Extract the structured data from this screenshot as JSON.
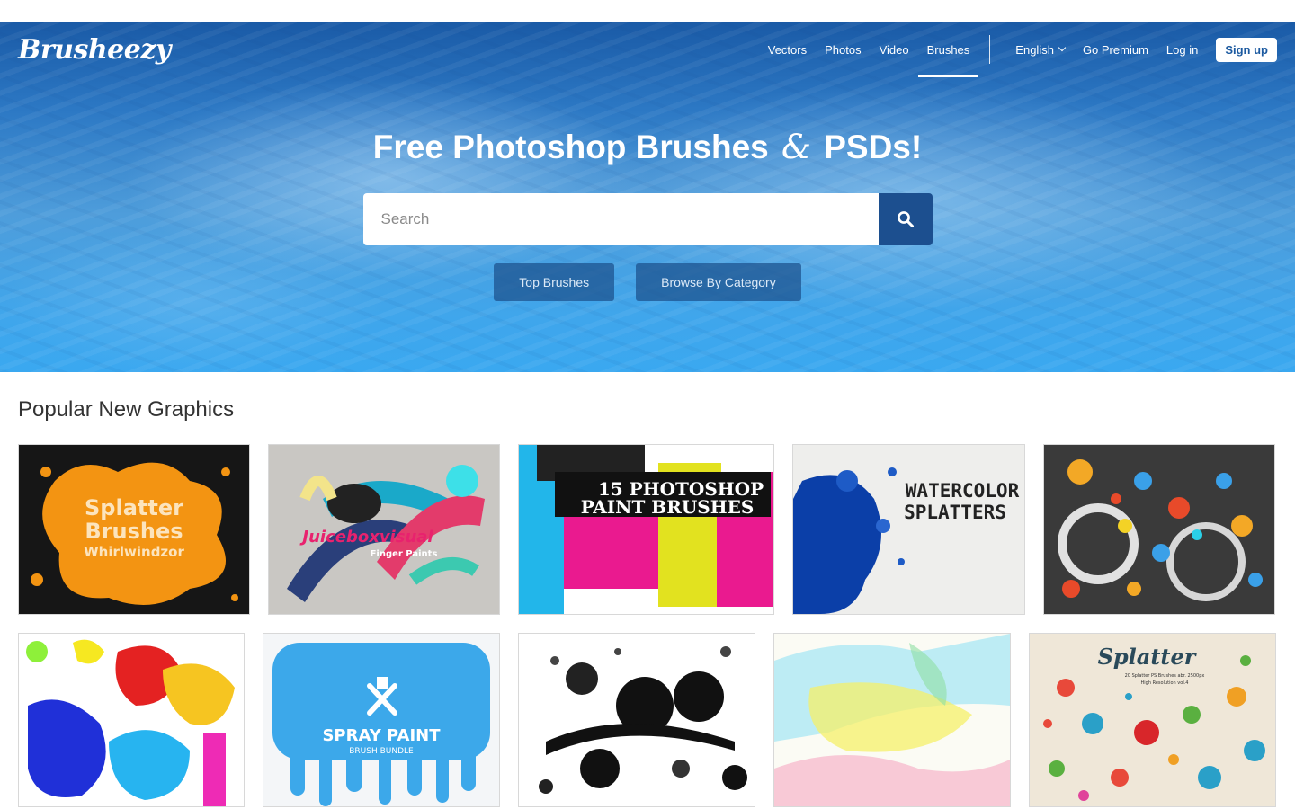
{
  "header": {
    "logo": "Brusheezy",
    "nav": [
      {
        "label": "Vectors",
        "active": false
      },
      {
        "label": "Photos",
        "active": false
      },
      {
        "label": "Video",
        "active": false
      },
      {
        "label": "Brushes",
        "active": true
      }
    ],
    "language": "English",
    "go_premium": "Go Premium",
    "login": "Log in",
    "signup": "Sign up"
  },
  "hero": {
    "title_part1": "Free Photoshop Brushes",
    "title_amp": "&",
    "title_part2": "PSDs!",
    "search_placeholder": "Search",
    "search_icon": "search-icon",
    "buttons": [
      "Top Brushes",
      "Browse By Category"
    ]
  },
  "section": {
    "title": "Popular New Graphics",
    "thumbnails": [
      {
        "text_lines": [
          "Splatter",
          "Brushes",
          "Whirlwindzor"
        ]
      },
      {
        "text_lines": [
          "Juiceboxvisual",
          "Finger Paints"
        ]
      },
      {
        "text_lines": [
          "15 PHOTOSHOP",
          "PAINT BRUSHES"
        ]
      },
      {
        "text_lines": [
          "WATERCOLOR",
          "SPLATTERS"
        ]
      },
      {
        "text_lines": []
      },
      {
        "text_lines": []
      },
      {
        "text_lines": [
          "SPRAY PAINT",
          "BRUSH BUNDLE"
        ]
      },
      {
        "text_lines": []
      },
      {
        "text_lines": []
      },
      {
        "text_lines": [
          "Splatter",
          "20 Splatter PS Brushes abr. 2500px",
          "High Resolution vol.4"
        ]
      }
    ]
  },
  "colors": {
    "brand_dark": "#1c4f8f",
    "hero_top": "#1a5aa6",
    "hero_bottom": "#3aa8f0",
    "text": "#333333"
  }
}
